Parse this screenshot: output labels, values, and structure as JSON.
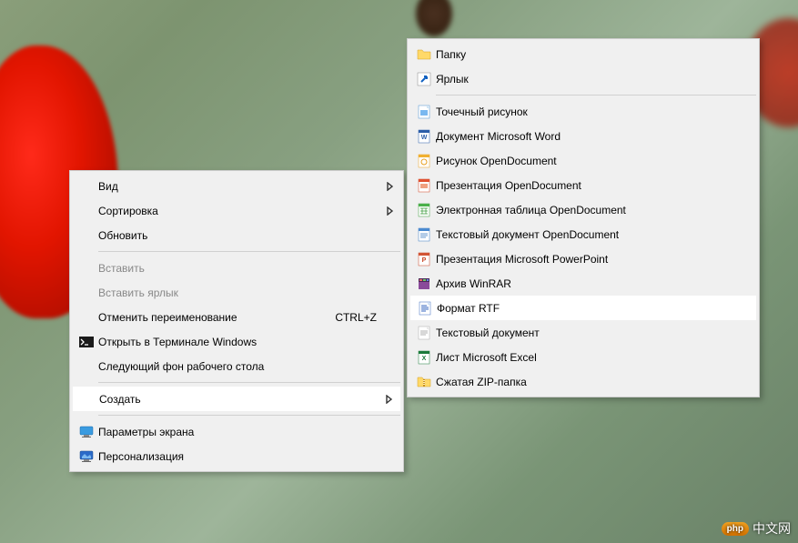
{
  "primaryMenu": {
    "items": [
      {
        "label": "Вид",
        "hasSubmenu": true,
        "icon": null
      },
      {
        "label": "Сортировка",
        "hasSubmenu": true,
        "icon": null
      },
      {
        "label": "Обновить",
        "hasSubmenu": false,
        "icon": null
      },
      {
        "sep": true
      },
      {
        "label": "Вставить",
        "hasSubmenu": false,
        "icon": null,
        "disabled": true
      },
      {
        "label": "Вставить ярлык",
        "hasSubmenu": false,
        "icon": null,
        "disabled": true
      },
      {
        "label": "Отменить переименование",
        "hasSubmenu": false,
        "icon": null,
        "shortcut": "CTRL+Z"
      },
      {
        "label": "Открыть в Терминале Windows",
        "hasSubmenu": false,
        "icon": "terminal"
      },
      {
        "label": "Следующий фон рабочего стола",
        "hasSubmenu": false,
        "icon": null
      },
      {
        "sep": true
      },
      {
        "label": "Создать",
        "hasSubmenu": true,
        "icon": null,
        "highlighted": true
      },
      {
        "sep": true
      },
      {
        "label": "Параметры экрана",
        "hasSubmenu": false,
        "icon": "display"
      },
      {
        "label": "Персонализация",
        "hasSubmenu": false,
        "icon": "personalize"
      }
    ]
  },
  "secondaryMenu": {
    "items": [
      {
        "label": "Папку",
        "icon": "folder"
      },
      {
        "label": "Ярлык",
        "icon": "shortcut"
      },
      {
        "sep": true
      },
      {
        "label": "Точечный рисунок",
        "icon": "bitmap"
      },
      {
        "label": "Документ Microsoft Word",
        "icon": "word"
      },
      {
        "label": "Рисунок OpenDocument",
        "icon": "odg"
      },
      {
        "label": "Презентация OpenDocument",
        "icon": "odp"
      },
      {
        "label": "Электронная таблица OpenDocument",
        "icon": "ods"
      },
      {
        "label": "Текстовый документ OpenDocument",
        "icon": "odt"
      },
      {
        "label": "Презентация Microsoft PowerPoint",
        "icon": "ppt"
      },
      {
        "label": "Архив WinRAR",
        "icon": "rar"
      },
      {
        "label": "Формат RTF",
        "icon": "rtf",
        "highlighted": true
      },
      {
        "label": "Текстовый документ",
        "icon": "txt"
      },
      {
        "label": "Лист Microsoft Excel",
        "icon": "xls"
      },
      {
        "label": "Сжатая ZIP-папка",
        "icon": "zip"
      }
    ]
  },
  "watermark": {
    "badge": "php",
    "text": "中文网"
  }
}
